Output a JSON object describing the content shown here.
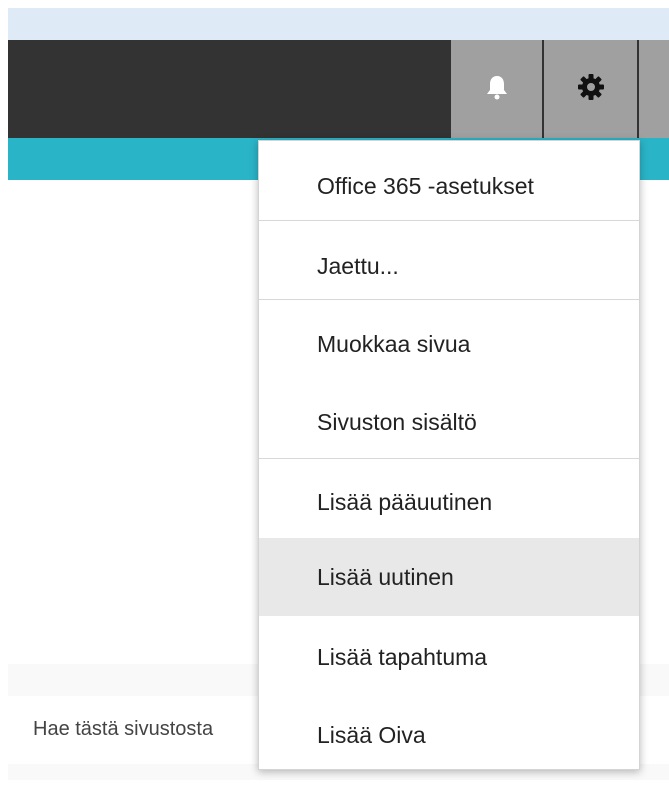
{
  "suite_bar": {
    "bell_icon": "bell-icon",
    "gear_icon": "gear-icon"
  },
  "settings_menu": {
    "items": [
      {
        "label": "Office 365 -asetukset"
      },
      {
        "label": "Jaettu..."
      },
      {
        "label": "Muokkaa sivua"
      },
      {
        "label": "Sivuston sisältö"
      },
      {
        "label": "Lisää pääuutinen"
      },
      {
        "label": "Lisää uutinen",
        "highlighted": true
      },
      {
        "label": "Lisää tapahtuma"
      },
      {
        "label": "Lisää Oiva"
      }
    ]
  },
  "search": {
    "placeholder": "Hae tästä sivustosta"
  },
  "colors": {
    "suite_bar": "#333333",
    "accent": "#2ab4c7",
    "top_strip": "#deebf7",
    "icon_button": "#a0a0a0",
    "menu_highlight": "#e8e8e8"
  }
}
